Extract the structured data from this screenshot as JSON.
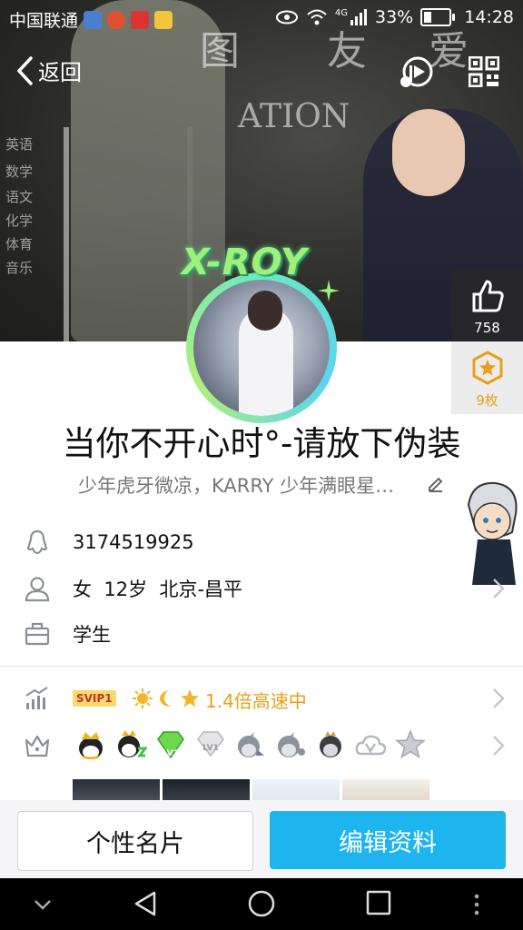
{
  "status_bar": {
    "carrier": "中国联通",
    "network": "4G",
    "battery": "33%",
    "time": "14:28"
  },
  "hero": {
    "doodles": [
      "图",
      "友",
      "爱",
      "ATION",
      "英语",
      "数学",
      "语文",
      "化学",
      "体育",
      "音乐"
    ],
    "overlay_text": "X-ROY"
  },
  "nav": {
    "back_label": "返回",
    "like_count": "758",
    "badge_count": "9枚"
  },
  "profile": {
    "nickname": "当你不开心时°-请放下伪装",
    "signature": "少年虎牙微凉，KARRY 少年满眼星…",
    "qq_number": "3174519925",
    "gender": "女",
    "age": "12岁",
    "location": "北京-昌平",
    "occupation": "学生"
  },
  "vip": {
    "tag": "SVIP1",
    "speed_text": "1.4倍高速中"
  },
  "levels": {
    "lv2_label": "LV2",
    "lv1_label": "LV1"
  },
  "buttons": {
    "card_label": "个性名片",
    "edit_label": "编辑资料"
  },
  "colors": {
    "accent": "#1eb4f0",
    "vip_orange": "#e8a01a"
  }
}
